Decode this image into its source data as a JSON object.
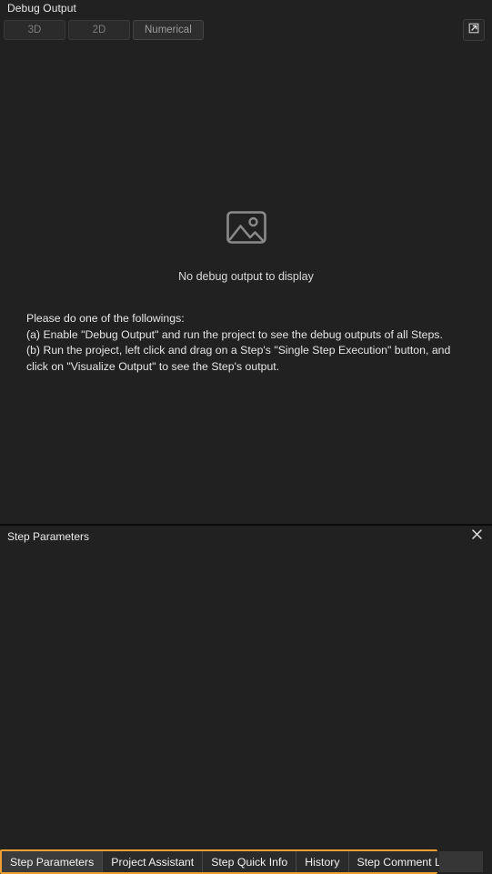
{
  "debug_panel": {
    "title": "Debug Output",
    "toolbar": {
      "modes": [
        {
          "label": "3D",
          "active": false
        },
        {
          "label": "2D",
          "active": false
        },
        {
          "label": "Numerical",
          "active": true
        }
      ],
      "popout_icon": "external-link-icon"
    },
    "empty_state": {
      "icon": "image-placeholder-icon",
      "message": "No debug output to display"
    },
    "instructions": [
      "Please do one of the followings:",
      "(a) Enable \"Debug Output\" and run the project to see the debug outputs of all Steps.",
      "(b) Run the project, left click and drag on a Step's \"Single Step Execution\" button, and click on \"Visualize Output\" to see the Step's output."
    ]
  },
  "step_panel": {
    "title": "Step Parameters",
    "close_icon": "close-icon"
  },
  "tabbar": {
    "tabs": [
      {
        "label": "Step Parameters",
        "active": true
      },
      {
        "label": "Project Assistant",
        "active": false
      },
      {
        "label": "Step Quick Info",
        "active": false
      },
      {
        "label": "History",
        "active": false
      },
      {
        "label": "Step Comment List",
        "active": false
      }
    ]
  },
  "colors": {
    "accent": "#f0a030",
    "panel_bg": "#212121",
    "tab_bg": "#2b2b2b",
    "tab_active_bg": "#3c3c3c",
    "text": "#eeeeee",
    "muted_text": "#7d7d7d"
  }
}
